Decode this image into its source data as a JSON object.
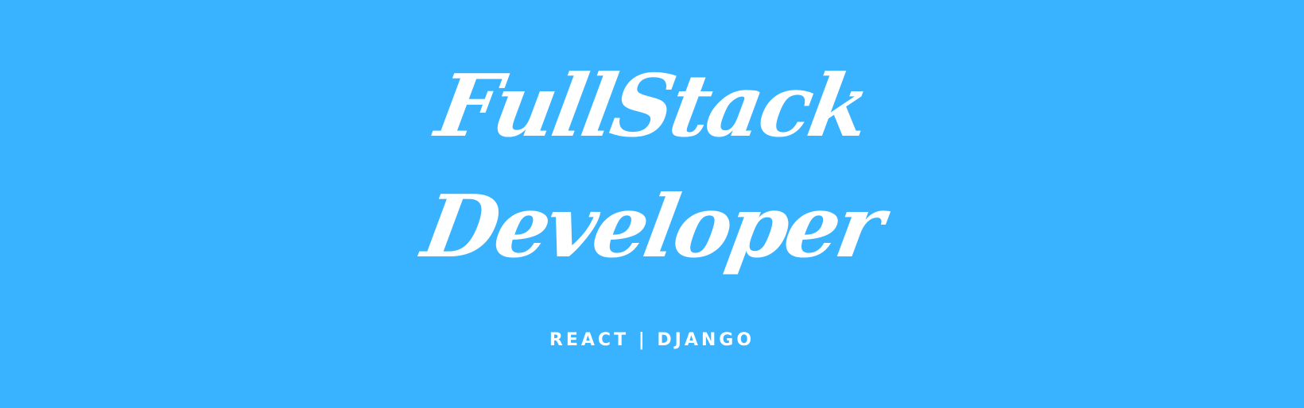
{
  "banner": {
    "title_line_1": "FullStack",
    "title_line_2": "Developer",
    "subtitle": "REACT | DJANGO",
    "background_color": "#39b3ff",
    "text_color": "#ffffff"
  }
}
